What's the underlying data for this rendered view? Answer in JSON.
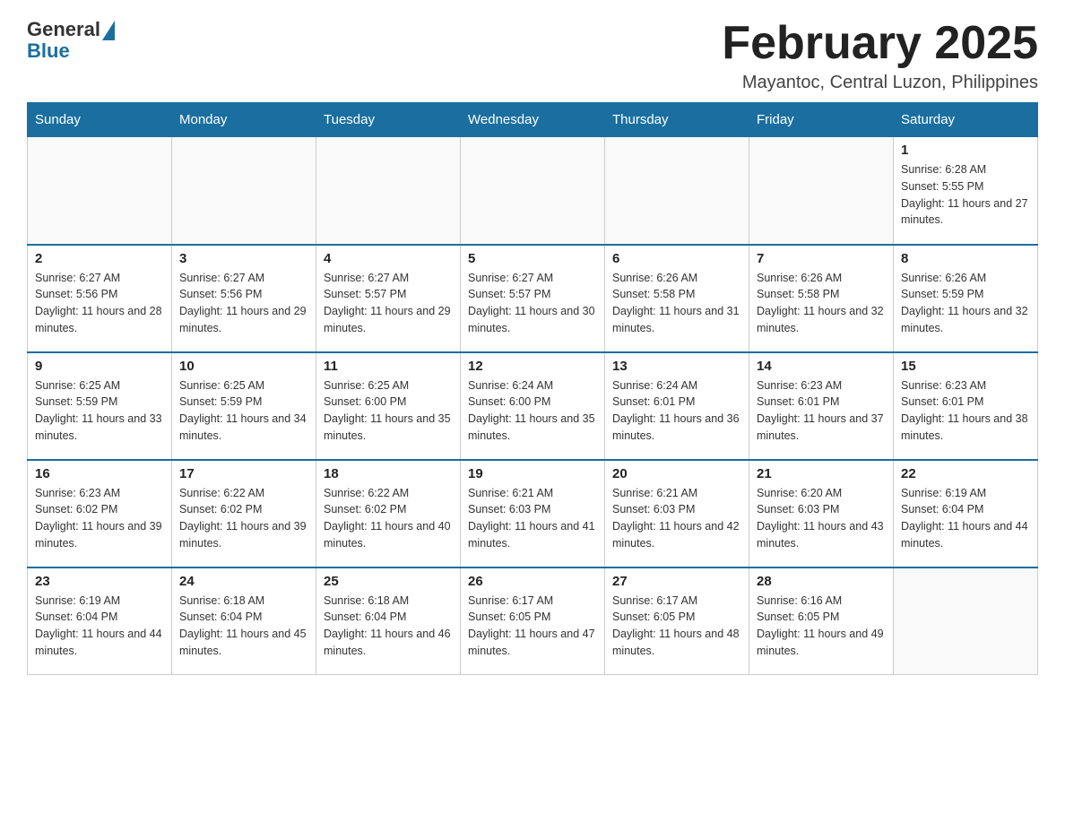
{
  "logo": {
    "general": "General",
    "blue": "Blue"
  },
  "header": {
    "month_title": "February 2025",
    "location": "Mayantoc, Central Luzon, Philippines"
  },
  "days_of_week": [
    "Sunday",
    "Monday",
    "Tuesday",
    "Wednesday",
    "Thursday",
    "Friday",
    "Saturday"
  ],
  "weeks": [
    [
      {
        "day": "",
        "info": ""
      },
      {
        "day": "",
        "info": ""
      },
      {
        "day": "",
        "info": ""
      },
      {
        "day": "",
        "info": ""
      },
      {
        "day": "",
        "info": ""
      },
      {
        "day": "",
        "info": ""
      },
      {
        "day": "1",
        "info": "Sunrise: 6:28 AM\nSunset: 5:55 PM\nDaylight: 11 hours and 27 minutes."
      }
    ],
    [
      {
        "day": "2",
        "info": "Sunrise: 6:27 AM\nSunset: 5:56 PM\nDaylight: 11 hours and 28 minutes."
      },
      {
        "day": "3",
        "info": "Sunrise: 6:27 AM\nSunset: 5:56 PM\nDaylight: 11 hours and 29 minutes."
      },
      {
        "day": "4",
        "info": "Sunrise: 6:27 AM\nSunset: 5:57 PM\nDaylight: 11 hours and 29 minutes."
      },
      {
        "day": "5",
        "info": "Sunrise: 6:27 AM\nSunset: 5:57 PM\nDaylight: 11 hours and 30 minutes."
      },
      {
        "day": "6",
        "info": "Sunrise: 6:26 AM\nSunset: 5:58 PM\nDaylight: 11 hours and 31 minutes."
      },
      {
        "day": "7",
        "info": "Sunrise: 6:26 AM\nSunset: 5:58 PM\nDaylight: 11 hours and 32 minutes."
      },
      {
        "day": "8",
        "info": "Sunrise: 6:26 AM\nSunset: 5:59 PM\nDaylight: 11 hours and 32 minutes."
      }
    ],
    [
      {
        "day": "9",
        "info": "Sunrise: 6:25 AM\nSunset: 5:59 PM\nDaylight: 11 hours and 33 minutes."
      },
      {
        "day": "10",
        "info": "Sunrise: 6:25 AM\nSunset: 5:59 PM\nDaylight: 11 hours and 34 minutes."
      },
      {
        "day": "11",
        "info": "Sunrise: 6:25 AM\nSunset: 6:00 PM\nDaylight: 11 hours and 35 minutes."
      },
      {
        "day": "12",
        "info": "Sunrise: 6:24 AM\nSunset: 6:00 PM\nDaylight: 11 hours and 35 minutes."
      },
      {
        "day": "13",
        "info": "Sunrise: 6:24 AM\nSunset: 6:01 PM\nDaylight: 11 hours and 36 minutes."
      },
      {
        "day": "14",
        "info": "Sunrise: 6:23 AM\nSunset: 6:01 PM\nDaylight: 11 hours and 37 minutes."
      },
      {
        "day": "15",
        "info": "Sunrise: 6:23 AM\nSunset: 6:01 PM\nDaylight: 11 hours and 38 minutes."
      }
    ],
    [
      {
        "day": "16",
        "info": "Sunrise: 6:23 AM\nSunset: 6:02 PM\nDaylight: 11 hours and 39 minutes."
      },
      {
        "day": "17",
        "info": "Sunrise: 6:22 AM\nSunset: 6:02 PM\nDaylight: 11 hours and 39 minutes."
      },
      {
        "day": "18",
        "info": "Sunrise: 6:22 AM\nSunset: 6:02 PM\nDaylight: 11 hours and 40 minutes."
      },
      {
        "day": "19",
        "info": "Sunrise: 6:21 AM\nSunset: 6:03 PM\nDaylight: 11 hours and 41 minutes."
      },
      {
        "day": "20",
        "info": "Sunrise: 6:21 AM\nSunset: 6:03 PM\nDaylight: 11 hours and 42 minutes."
      },
      {
        "day": "21",
        "info": "Sunrise: 6:20 AM\nSunset: 6:03 PM\nDaylight: 11 hours and 43 minutes."
      },
      {
        "day": "22",
        "info": "Sunrise: 6:19 AM\nSunset: 6:04 PM\nDaylight: 11 hours and 44 minutes."
      }
    ],
    [
      {
        "day": "23",
        "info": "Sunrise: 6:19 AM\nSunset: 6:04 PM\nDaylight: 11 hours and 44 minutes."
      },
      {
        "day": "24",
        "info": "Sunrise: 6:18 AM\nSunset: 6:04 PM\nDaylight: 11 hours and 45 minutes."
      },
      {
        "day": "25",
        "info": "Sunrise: 6:18 AM\nSunset: 6:04 PM\nDaylight: 11 hours and 46 minutes."
      },
      {
        "day": "26",
        "info": "Sunrise: 6:17 AM\nSunset: 6:05 PM\nDaylight: 11 hours and 47 minutes."
      },
      {
        "day": "27",
        "info": "Sunrise: 6:17 AM\nSunset: 6:05 PM\nDaylight: 11 hours and 48 minutes."
      },
      {
        "day": "28",
        "info": "Sunrise: 6:16 AM\nSunset: 6:05 PM\nDaylight: 11 hours and 49 minutes."
      },
      {
        "day": "",
        "info": ""
      }
    ]
  ]
}
